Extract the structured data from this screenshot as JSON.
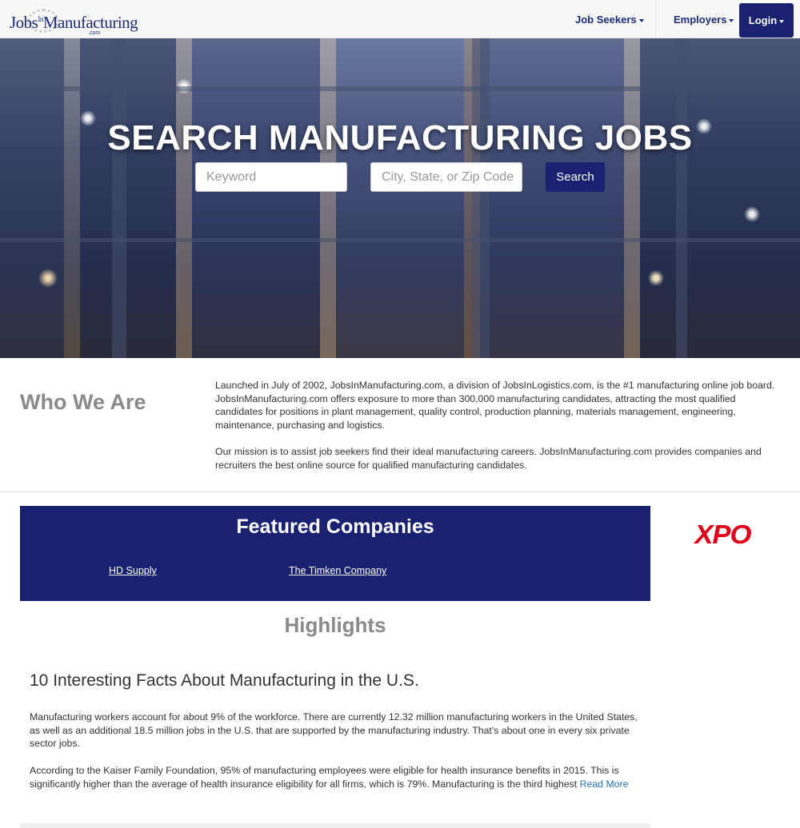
{
  "header": {
    "logo_text": "JobsInManufacturing",
    "logo_in": "In",
    "logo_main": "Manufacturing",
    "logo_jobs": "Jobs",
    "logo_domain": ".com",
    "nav": {
      "job_seekers": "Job Seekers",
      "employers": "Employers",
      "login": "Login"
    },
    "colors": {
      "brand": "#1a2170"
    }
  },
  "hero": {
    "title": "SEARCH MANUFACTURING JOBS",
    "keyword_placeholder": "Keyword",
    "location_placeholder": "City, State, or Zip Code",
    "search_label": "Search"
  },
  "who_we_are": {
    "title": "Who We Are",
    "paragraph1": "Launched in July of 2002, JobsInManufacturing.com, a division of JobsInLogistics.com, is the #1 manufacturing online job board. JobsInManufacturing.com offers exposure to more than 300,000 manufacturing candidates, attracting the most qualified candidates for positions in plant management, quality control, production planning, materials management, engineering, maintenance, purchasing and logistics.",
    "paragraph2": "Our mission is to assist job seekers find their ideal manufacturing careers. JobsInManufacturing.com provides companies and recruiters the best online source for qualified manufacturing candidates."
  },
  "featured": {
    "title": "Featured Companies",
    "companies": [
      "HD Supply",
      "The Timken Company"
    ],
    "sponsor_logo": "XPO"
  },
  "highlights": {
    "title": "Highlights",
    "article_title": "10 Interesting Facts About Manufacturing in the U.S.",
    "paragraph1": "Manufacturing workers account for about 9% of the workforce. There are currently 12.32 million manufacturing workers in the United States, as well as an additional 18.5 million jobs in the U.S. that are supported by the manufacturing industry. That's about one in every six private sector jobs.",
    "paragraph2": "According to the Kaiser Family Foundation, 95% of manufacturing employees were eligible for health insurance benefits in 2015. This is significantly higher than the average of health insurance eligibility for all firms, which is 79%. Manufacturing is the third highest",
    "read_more": "Read More"
  }
}
